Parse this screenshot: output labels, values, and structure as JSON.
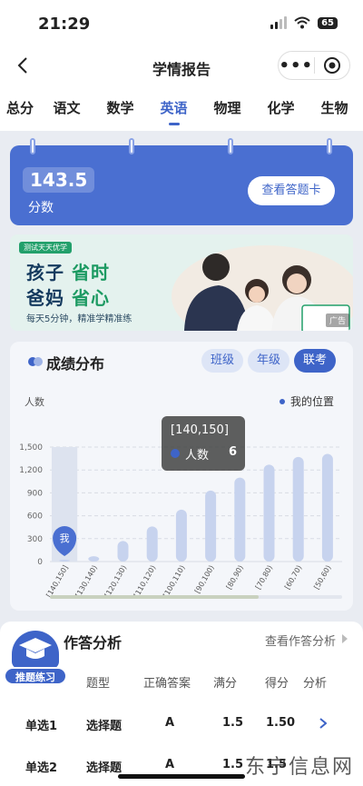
{
  "status": {
    "time": "21:29",
    "battery": "65"
  },
  "nav": {
    "title": "学情报告",
    "more_label": "•••"
  },
  "tabs": [
    {
      "label": "总分"
    },
    {
      "label": "语文"
    },
    {
      "label": "数学"
    },
    {
      "label": "英语",
      "active": true
    },
    {
      "label": "物理"
    },
    {
      "label": "化学"
    },
    {
      "label": "生物"
    }
  ],
  "score": {
    "value": "143.5",
    "label": "分数",
    "answer_card_button": "查看答题卡"
  },
  "ad": {
    "tag": "测试天天优学",
    "line1_a": "孩子",
    "line1_b": "省时",
    "line2_a": "爸妈",
    "line2_b": "省心",
    "subtitle": "每天5分钟，精准学精准练",
    "label": "广告"
  },
  "distribution": {
    "title": "成绩分布",
    "scopes": [
      "班级",
      "年级",
      "联考"
    ],
    "active_scope": "联考",
    "my_position_label": "我的位置",
    "my_marker": "我"
  },
  "chart_data": {
    "type": "bar",
    "ylabel": "人数",
    "ylim": [
      0,
      1500
    ],
    "yticks": [
      0,
      300,
      600,
      900,
      1200,
      1500
    ],
    "ytick_labels": [
      "0",
      "300",
      "600",
      "900",
      "1,200",
      "1,500"
    ],
    "categories": [
      "[140,150]",
      "[130,140)",
      "[120,130)",
      "[110,120)",
      "[100,110)",
      "[90,100)",
      "[80,90)",
      "[70,80)",
      "[60,70)",
      "[50,60)"
    ],
    "series": [
      {
        "name": "人数",
        "values": [
          6,
          70,
          270,
          460,
          680,
          930,
          1100,
          1270,
          1370,
          1410
        ]
      }
    ],
    "highlight_index": 0,
    "grid": true,
    "tooltip": {
      "title": "[140,150]",
      "series": "人数",
      "value": "6"
    }
  },
  "analysis": {
    "title": "作答分析",
    "link": "查看作答分析",
    "columns": [
      "题型",
      "正确答案",
      "满分",
      "得分",
      "分析"
    ],
    "rows": [
      {
        "name": "单选1",
        "type": "选择题",
        "answer": "A",
        "full": "1.5",
        "score": "1.50"
      },
      {
        "name": "单选2",
        "type": "选择题",
        "answer": "A",
        "full": "1.5",
        "score": "1.5"
      }
    ]
  },
  "practice": {
    "label": "推题练习"
  },
  "watermark": "东宁信息网",
  "colors": {
    "accent": "#3e64c8",
    "bar": "#c7d3ee",
    "highlight_bar": "#dde3ef"
  }
}
